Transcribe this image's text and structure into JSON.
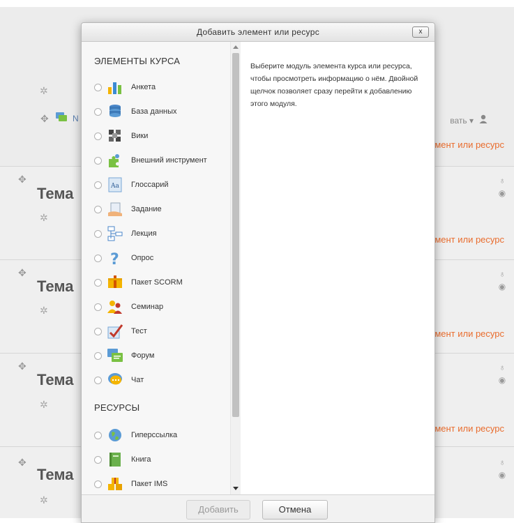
{
  "dialog": {
    "title": "Добавить элемент или ресурс",
    "close_label": "x",
    "sections": [
      {
        "title": "ЭЛЕМЕНТЫ КУРСА",
        "items": [
          {
            "label": "Анкета",
            "icon": "feedback-icon"
          },
          {
            "label": "База данных",
            "icon": "database-icon"
          },
          {
            "label": "Вики",
            "icon": "wiki-icon"
          },
          {
            "label": "Внешний инструмент",
            "icon": "puzzle-icon"
          },
          {
            "label": "Глоссарий",
            "icon": "glossary-icon"
          },
          {
            "label": "Задание",
            "icon": "assignment-icon"
          },
          {
            "label": "Лекция",
            "icon": "lesson-icon"
          },
          {
            "label": "Опрос",
            "icon": "question-icon"
          },
          {
            "label": "Пакет SCORM",
            "icon": "scorm-package-icon"
          },
          {
            "label": "Семинар",
            "icon": "workshop-icon"
          },
          {
            "label": "Тест",
            "icon": "quiz-icon"
          },
          {
            "label": "Форум",
            "icon": "forum-icon"
          },
          {
            "label": "Чат",
            "icon": "chat-icon"
          }
        ]
      },
      {
        "title": "РЕСУРСЫ",
        "items": [
          {
            "label": "Гиперссылка",
            "icon": "url-icon"
          },
          {
            "label": "Книга",
            "icon": "book-icon"
          },
          {
            "label": "Пакет IMS",
            "icon": "ims-package-icon"
          }
        ]
      }
    ],
    "info_text": "Выберите модуль элемента курса или ресурса, чтобы просмотреть информацию о нём. Двойной щелчок позволяет сразу перейти к добавлению этого модуля.",
    "add_button": "Добавить",
    "cancel_button": "Отмена"
  },
  "background": {
    "top_fragment": "N",
    "edit_fragment": "вать",
    "add_link_fragment": "мент или ресурс",
    "sections": [
      {
        "title": "Тема"
      },
      {
        "title": "Тема"
      },
      {
        "title": "Тема"
      },
      {
        "title": "Тема"
      }
    ]
  },
  "colors": {
    "accent_link": "#e96c2d",
    "section_bg": "#efefef"
  }
}
